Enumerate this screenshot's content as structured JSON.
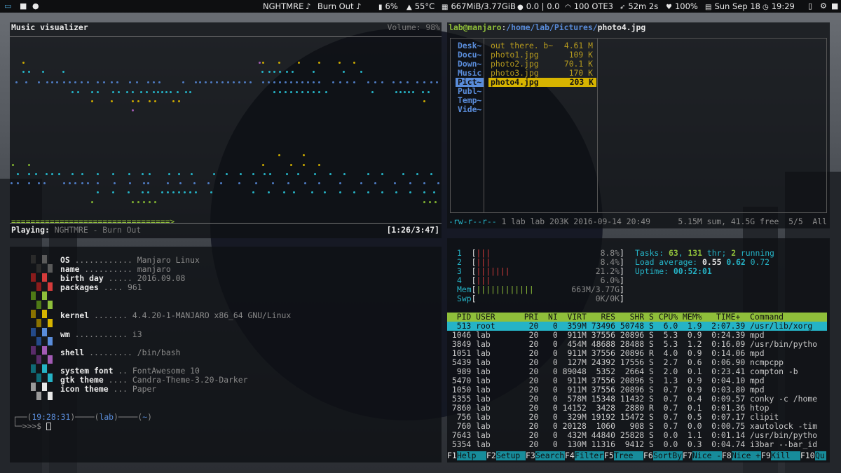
{
  "topbar": {
    "song": "NGHTMRE",
    "song_title": "Burn Out",
    "battery": "6%",
    "temp": "55°C",
    "memory": "667MiB/3.77GiB",
    "network_io": "0.0 | 0.0",
    "wifi": "100 OTE3",
    "timer": "52m 2s",
    "brightness": "100%",
    "date": "Sun Sep 18",
    "time": "19:29"
  },
  "visualizer": {
    "title": "Music visualizer",
    "volume": "Volume: 98%",
    "progress_bar": "=================================>",
    "playing_label": "Playing:",
    "playing_track": "NGHTMRE - Burn Out",
    "position": "[1:26/3:47]"
  },
  "sysinfo": {
    "rows": [
      {
        "key": "OS",
        "dots": "............",
        "value": "Manjaro Linux"
      },
      {
        "key": "name",
        "dots": "..........",
        "value": "manjaro"
      },
      {
        "key": "birth day",
        "dots": ".....",
        "value": "2016.09.08"
      },
      {
        "key": "packages",
        "dots": "....",
        "value": "961"
      },
      {
        "key": "kernel",
        "dots": ".......",
        "value": "4.4.20-1-MANJARO x86_64 GNU/Linux"
      },
      {
        "key": "wm",
        "dots": "...........",
        "value": "i3"
      },
      {
        "key": "shell",
        "dots": ".........",
        "value": "/bin/bash"
      },
      {
        "key": "system font",
        "dots": "..",
        "value": "FontAwesome 10"
      },
      {
        "key": "gtk theme",
        "dots": "....",
        "value": "Candra-Theme-3.20-Darker"
      },
      {
        "key": "icon theme",
        "dots": "...",
        "value": "Paper"
      }
    ],
    "prompt_line1_a": "┌──(",
    "prompt_time": "19:28:31",
    "prompt_line1_b": ")────(",
    "prompt_user": "lab",
    "prompt_line1_c": ")────(",
    "prompt_dir": "~",
    "prompt_line1_d": ")",
    "prompt_line2": "└─>>>$"
  },
  "ranger": {
    "path_user": "lab@manjaro",
    "path_sep": ":",
    "path_dir": "/home/lab/Pictures/",
    "path_file": "photo4.jpg",
    "dirs": [
      "Desk~",
      "Docu~",
      "Down~",
      "Music",
      "Pict~",
      "Publ~",
      "Temp~",
      "Vide~"
    ],
    "files": [
      {
        "name": "out there. b~",
        "size": "4.61 M"
      },
      {
        "name": "photo1.jpg",
        "size": "109 K"
      },
      {
        "name": "photo2.jpg",
        "size": "70.1 K"
      },
      {
        "name": "photo3.jpg",
        "size": "170 K"
      },
      {
        "name": "photo4.jpg",
        "size": "203 K"
      }
    ],
    "status_perms": "-rw-r--r--",
    "status_info": "1 lab lab 203K 2016-09-14 20:49",
    "status_right": "5.15M sum, 41.5G free  5/5  All"
  },
  "htop": {
    "cpus": [
      {
        "n": "1",
        "bars": "|||",
        "pct": "8.8%"
      },
      {
        "n": "2",
        "bars": "|||",
        "pct": "8.4%"
      },
      {
        "n": "3",
        "bars": "|||||||",
        "pct": "21.2%"
      },
      {
        "n": "4",
        "bars": "|||",
        "pct": "6.0%"
      }
    ],
    "mem_label": "Mem",
    "mem_bars": "||||||||||||",
    "mem_val": "663M/3.77G",
    "swp_label": "Swp",
    "swp_val": "0K/0K",
    "tasks_label": "Tasks:",
    "tasks": "63",
    "thr": "131",
    "thr_label": "thr;",
    "running": "2",
    "running_label": "running",
    "load_label": "Load average:",
    "load1": "0.55",
    "load5": "0.62",
    "load15": "0.72",
    "uptime_label": "Uptime:",
    "uptime": "00:52:01",
    "columns": "  PID USER      PRI  NI  VIRT   RES   SHR S CPU% MEM%   TIME+  Command",
    "processes": [
      "  513 root       20   0  359M 73496 50748 S  6.0  1.9  2:07.39 /usr/lib/xorg",
      " 1046 lab        20   0  911M 37556 20896 S  5.3  0.9  0:24.39 mpd",
      " 3849 lab        20   0  454M 48688 28488 S  5.3  1.2  0:16.09 /usr/bin/pytho",
      " 1051 lab        20   0  911M 37556 20896 R  4.0  0.9  0:14.06 mpd",
      " 5439 lab        20   0  127M 24392 17556 S  2.7  0.6  0:06.90 ncmpcpp",
      "  989 lab        20   0 89048  5352  2664 S  2.0  0.1  0:23.41 compton -b",
      " 5470 lab        20   0  911M 37556 20896 S  1.3  0.9  0:04.10 mpd",
      " 1050 lab        20   0  911M 37556 20896 S  0.7  0.9  0:03.80 mpd",
      " 5355 lab        20   0  578M 15348 11432 S  0.7  0.4  0:09.57 conky -c /home",
      " 7860 lab        20   0 14152  3428  2880 R  0.7  0.1  0:01.36 htop",
      "  756 lab        20   0  329M 19192 15472 S  0.7  0.5  0:07.17 clipit",
      "  760 lab        20   0 20128  1060   908 S  0.7  0.0  0:00.75 xautolock -tim",
      " 7643 lab        20   0  432M 44840 25828 S  0.0  1.1  0:01.14 /usr/bin/pytho",
      " 5354 lab        20   0  130M 11316  9412 S  0.0  0.3  0:04.74 i3bar --bar_id"
    ],
    "fkeys": [
      {
        "k": "F1",
        "l": "Help"
      },
      {
        "k": "F2",
        "l": "Setup"
      },
      {
        "k": "F3",
        "l": "Search"
      },
      {
        "k": "F4",
        "l": "Filter"
      },
      {
        "k": "F5",
        "l": "Tree"
      },
      {
        "k": "F6",
        "l": "SortBy"
      },
      {
        "k": "F7",
        "l": "Nice -"
      },
      {
        "k": "F8",
        "l": "Nice +"
      },
      {
        "k": "F9",
        "l": "Kill"
      },
      {
        "k": "F10",
        "l": "Qu"
      }
    ]
  },
  "colors": {
    "accent_green": "#8fbf3a",
    "accent_cyan": "#25b3c6",
    "accent_yellow": "#d7b400",
    "ranger_highlight": "#d7b400"
  }
}
